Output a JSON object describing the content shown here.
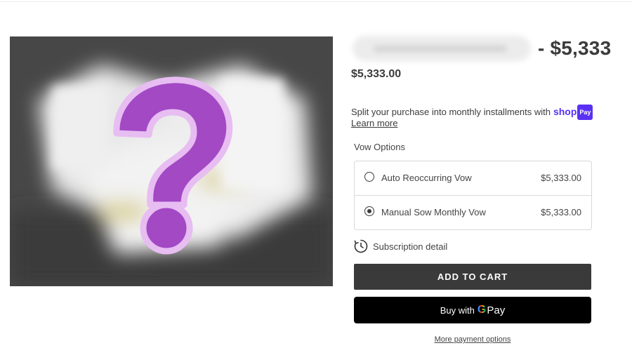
{
  "product": {
    "title_price": "- $5,333",
    "price": "$5,333.00",
    "image_icon": "question-mark"
  },
  "installments": {
    "text": "Split your purchase into monthly installments with",
    "brand": "shop",
    "badge": "Pay",
    "learn_more": "Learn more"
  },
  "options": {
    "label": "Vow Options",
    "items": [
      {
        "name": "Auto Reoccurring Vow",
        "price": "$5,333.00",
        "selected": false
      },
      {
        "name": "Manual Sow Monthly Vow",
        "price": "$5,333.00",
        "selected": true
      }
    ]
  },
  "subscription": {
    "label": "Subscription detail",
    "icon": "clock-history-icon"
  },
  "buttons": {
    "add_to_cart": "ADD TO CART",
    "gpay_prefix": "Buy with",
    "gpay_g": "G",
    "gpay_pay": "Pay",
    "more_payment": "More payment options"
  },
  "colors": {
    "accent_shop": "#5a31f4",
    "question_mark": "#a349c4",
    "add_to_cart_bg": "#3a3a3a",
    "gpay_bg": "#000000"
  }
}
